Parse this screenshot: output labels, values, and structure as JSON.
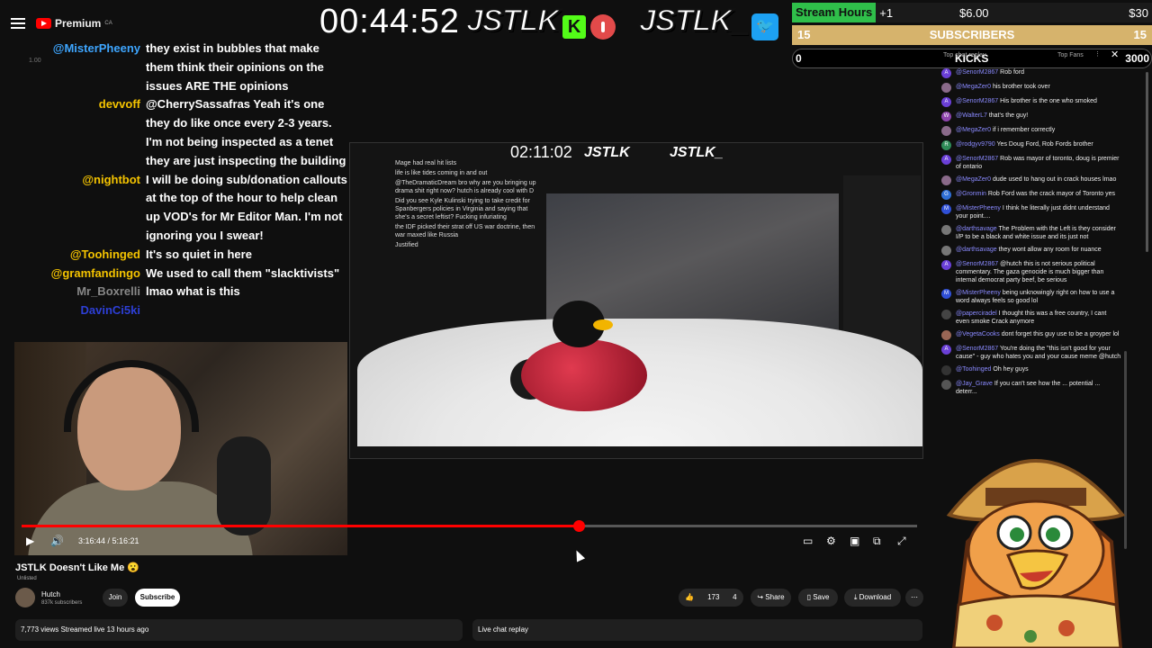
{
  "topbar": {
    "logo_text": "Premium",
    "logo_sup": "CA",
    "timer": "00:44:52",
    "brand1": "JSTLK",
    "brand2": "JSTLK_"
  },
  "stats": {
    "stream_hours_label": "Stream Hours",
    "stream_hours_plus": "+1",
    "usd": "$6.00",
    "usd_goal": "$30",
    "subs_left": "15",
    "subs_label": "SUBSCRIBERS",
    "subs_right": "15",
    "kicks_left": "0",
    "kicks_label": "KICKS",
    "kicks_right": "3000"
  },
  "left_chat": {
    "volume_hint": "1.00",
    "messages": [
      {
        "user": "@MisterPheeny",
        "color": "#3ea6ff",
        "text": "they exist in bubbles that make them think their opinions on the issues ARE THE opinions"
      },
      {
        "user": "devvoff",
        "color": "#f5c400",
        "text": "@CherrySassafras Yeah it's one they do like once every 2-3 years. I'm not being inspected as a tenet they are just inspecting the building"
      },
      {
        "user": "@nightbot",
        "color": "#f5c400",
        "text": "I will be doing sub/donation callouts at the top of the hour to help clean up VOD's for Mr Editor Man. I'm not ignoring you I swear!"
      },
      {
        "user": "@Toohinged",
        "color": "#f5c400",
        "text": "It's so quiet in here"
      },
      {
        "user": "@gramfandingo",
        "color": "#f5c400",
        "text": "We used to call them \"slacktivists\""
      },
      {
        "user": "Mr_Boxrelli",
        "color": "#888888",
        "text": "lmao what is this"
      },
      {
        "user": "DavinCi5ki",
        "color": "#2d3fd6",
        "text": ""
      }
    ]
  },
  "inner_stream": {
    "timer": "02:11:02",
    "brand1": "JSTLK",
    "brand2": "JSTLK_",
    "chat_lines": [
      "Mage had real hit lists",
      "life is like tides coming in and out",
      "@TheDramaticDream bro why are you bringing up drama shit right now? hutch is already cool with D",
      "Did you see Kyle Kulinski trying to take credit for Spanbergers policies in Virginia and saying that she's a secret leftist? Fucking infuriating",
      "the IDF picked their strat off US war doctrine, then war maxed like Russia",
      "Justified"
    ]
  },
  "player": {
    "time": "3:16:44 / 5:16:21",
    "progress": 0.622
  },
  "video": {
    "title": "JSTLK Doesn't Like Me",
    "title_emoji": "😮",
    "unlisted": "Unlisted",
    "channel": "Hutch",
    "subscribers": "837k subscribers",
    "join": "Join",
    "subscribe": "Subscribe",
    "likes": "173",
    "dislikes": "4",
    "share": "Share",
    "save": "Save",
    "download": "Download",
    "views": "7,773 views  Streamed live 13 hours ago",
    "live_chat": "Live chat replay"
  },
  "right_chat": {
    "top_fans": "Top Fans",
    "top_chat": "Top chat replay",
    "messages": [
      {
        "user": "@SenorM2867",
        "text": "Rob ford",
        "av": "#6a3fd6",
        "letter": "A"
      },
      {
        "user": "@MegaZer0",
        "text": "his brother took over",
        "av": "#8a6a8a",
        "letter": ""
      },
      {
        "user": "@SenorM2867",
        "text": "His brother is the one who smoked",
        "av": "#6a3fd6",
        "letter": "A"
      },
      {
        "user": "@WalterL7",
        "text": "that's the guy!",
        "av": "#8e44ad",
        "letter": "W"
      },
      {
        "user": "@MegaZer0",
        "text": "if i remember correctly",
        "av": "#8a6a8a",
        "letter": ""
      },
      {
        "user": "@rodgyv9790",
        "text": "Yes Doug Ford, Rob Fords brother",
        "av": "#2e8b57",
        "letter": "R"
      },
      {
        "user": "@SenorM2867",
        "text": "Rob was mayor of toronto, doug is premier of ontario",
        "av": "#6a3fd6",
        "letter": "A"
      },
      {
        "user": "@MegaZer0",
        "text": "dude used to hang out in crack houses lmao",
        "av": "#8a6a8a",
        "letter": ""
      },
      {
        "user": "@Gronmin",
        "text": "Rob Ford was the crack mayor of Toronto yes",
        "av": "#2f6fd6",
        "letter": "G"
      },
      {
        "user": "@MisterPheeny",
        "text": "I think he literally just didnt understand your point....",
        "av": "#2f4fd6",
        "letter": "M"
      },
      {
        "user": "@darthsavage",
        "text": "The Problem with the Left is they consider I/P to be a black and white issue and its just not",
        "av": "#777777",
        "letter": ""
      },
      {
        "user": "@darthsavage",
        "text": "they wont allow any room for nuance",
        "av": "#777777",
        "letter": ""
      },
      {
        "user": "@SenorM2867",
        "text": "@hutch this is not serious political commentary. The gaza genocide is much bigger than internal democrat party beef, be serious",
        "av": "#6a3fd6",
        "letter": "A"
      },
      {
        "user": "@MisterPheeny",
        "text": "being unknowingly right on how to use a word always feels so good lol",
        "av": "#2f4fd6",
        "letter": "M"
      },
      {
        "user": "@paperciradel",
        "text": "I thought this was a free country, I cant even smoke Crack anymore",
        "av": "#444444",
        "letter": ""
      },
      {
        "user": "@VegetaCooks",
        "text": "dont forget this guy use to be a groyper lol",
        "av": "#996655",
        "letter": ""
      },
      {
        "user": "@SenorM2867",
        "text": "You're doing the \"this isn't good for your cause\" - guy who hates you and your cause meme @hutch",
        "av": "#6a3fd6",
        "letter": "A"
      },
      {
        "user": "@Toohinged",
        "text": "Oh hey guys",
        "av": "#333333",
        "letter": ""
      },
      {
        "user": "@Jay_Grave",
        "text": "If you can't see how the ... potential ... deterr...",
        "av": "#555555",
        "letter": ""
      }
    ]
  }
}
